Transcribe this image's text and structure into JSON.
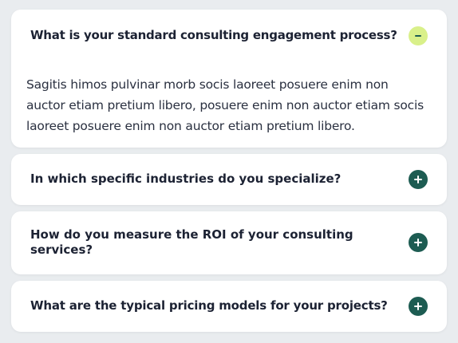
{
  "faq": {
    "items": [
      {
        "question": "What is your standard consulting engagement process?",
        "expanded": true,
        "toggle_icon": "minus-icon",
        "answer": "Sagitis himos pulvinar morb socis laoreet posuere enim non auctor etiam pretium libero, posuere enim non auctor etiam socis laoreet posuere enim non auctor etiam pretium libero."
      },
      {
        "question": "In which specific industries do you specialize?",
        "expanded": false,
        "toggle_icon": "plus-icon"
      },
      {
        "question": "How do you measure the ROI of your consulting services?",
        "expanded": false,
        "toggle_icon": "plus-icon"
      },
      {
        "question": "What are the typical pricing models for your projects?",
        "expanded": false,
        "toggle_icon": "plus-icon"
      }
    ],
    "colors": {
      "background": "#e9ecef",
      "card": "#ffffff",
      "expanded_toggle": "#d9f08a",
      "collapsed_toggle": "#1d5c52",
      "text": "#1c2233"
    }
  }
}
